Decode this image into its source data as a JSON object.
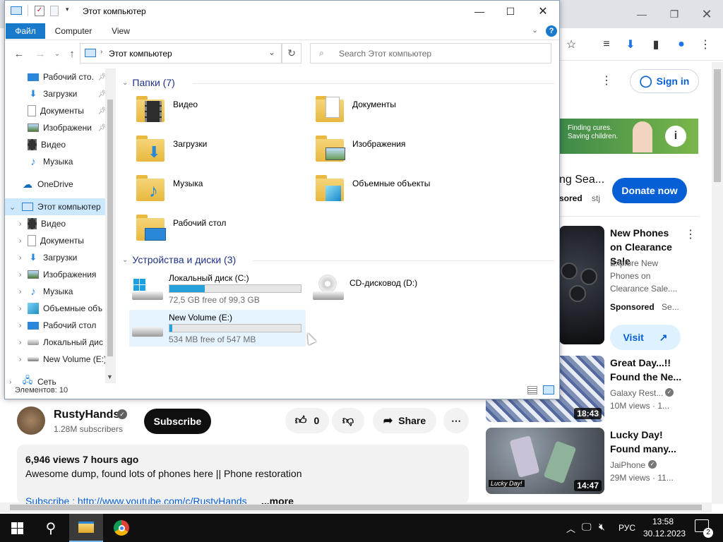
{
  "explorer": {
    "window_title": "Этот компьютер",
    "ribbon_tabs": [
      "Файл",
      "Computer",
      "View"
    ],
    "address": "Этот компьютер",
    "search_placeholder": "Search Этот компьютер",
    "status": "Элементов: 10",
    "nav_quick": [
      {
        "label": "Рабочий сто.",
        "icon": "desktop-icon"
      },
      {
        "label": "Загрузки",
        "icon": "downloads-icon"
      },
      {
        "label": "Документы",
        "icon": "documents-icon"
      },
      {
        "label": "Изображени",
        "icon": "pictures-icon"
      },
      {
        "label": "Видео",
        "icon": "videos-icon"
      },
      {
        "label": "Музыка",
        "icon": "music-icon"
      }
    ],
    "nav_onedrive": "OneDrive",
    "nav_thispc": "Этот компьютер",
    "nav_pc_children": [
      {
        "label": "Видео",
        "icon": "videos-icon"
      },
      {
        "label": "Документы",
        "icon": "documents-icon"
      },
      {
        "label": "Загрузки",
        "icon": "downloads-icon"
      },
      {
        "label": "Изображения",
        "icon": "pictures-icon"
      },
      {
        "label": "Музыка",
        "icon": "music-icon"
      },
      {
        "label": "Объемные объ",
        "icon": "3d-objects-icon"
      },
      {
        "label": "Рабочий стол",
        "icon": "desktop-icon"
      },
      {
        "label": "Локальный дис",
        "icon": "drive-icon"
      },
      {
        "label": "New Volume (E:)",
        "icon": "drive-icon"
      }
    ],
    "nav_network": "Сеть",
    "folders_header": "Папки (7)",
    "folders": [
      "Видео",
      "Документы",
      "Загрузки",
      "Изображения",
      "Музыка",
      "Объемные объекты",
      "Рабочий стол"
    ],
    "drives_header": "Устройства и диски (3)",
    "drives": [
      {
        "name": "Локальный диск (C:)",
        "free": "72,5 GB free of 99,3 GB",
        "used_fraction": 0.27
      },
      {
        "name": "CD-дисковод (D:)"
      },
      {
        "name": "New Volume (E:)",
        "free": "534 MB free of 547 MB",
        "used_fraction": 0.024
      }
    ]
  },
  "youtube": {
    "signin": "Sign in",
    "ad_banner_text": "Finding cures. Saving children.",
    "ad_title_partial": "ng Sea...",
    "ad_sponsored": "sored",
    "ad_domain": "stj",
    "donate": "Donate now",
    "cards": [
      {
        "title": "New Phones on Clearance Sale",
        "desc": "Explore New Phones on Clearance Sale....",
        "sponsored": "Sponsored",
        "sub": "Se...",
        "visit": "Visit"
      },
      {
        "title": "Great Day...!! Found the Ne...",
        "channel": "Galaxy Rest...",
        "meta": "10M views · 1...",
        "duration": "18:43"
      },
      {
        "title": "Lucky Day! Found many...",
        "channel": "JaiPhone",
        "meta": "29M views · 11...",
        "duration": "14:47"
      }
    ],
    "channel_name": "RustyHands",
    "subscribers": "1.28M subscribers",
    "subscribe": "Subscribe",
    "likes": "0",
    "share": "Share",
    "views": "6,946 views  7 hours ago",
    "description": "Awesome dump, found lots of phones here || Phone restoration",
    "link_line": "Subscribe : http://www.youtube.com/c/RustyHands",
    "more": "...more"
  },
  "taskbar": {
    "lang": "РУС",
    "time": "13:58",
    "date": "30.12.2023",
    "notifications": "2"
  },
  "colors": {
    "accent": "#0063b1",
    "youtube_blue": "#065fd4",
    "drive_fill": "#26a0da",
    "selection": "#cce8ff"
  }
}
